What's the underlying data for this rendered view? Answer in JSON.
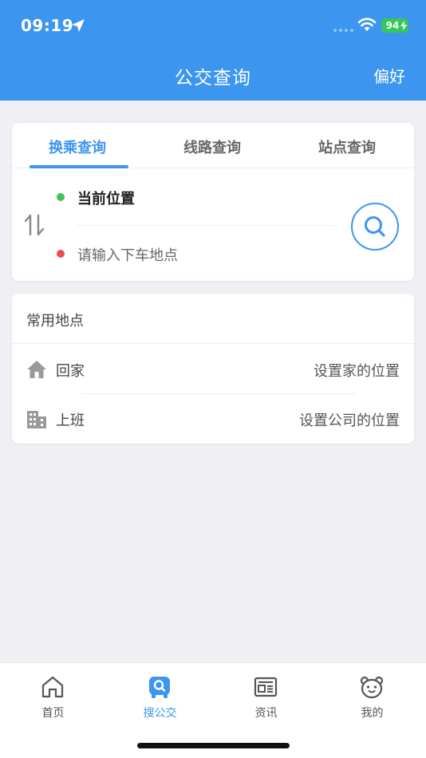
{
  "status_bar": {
    "time": "09:19",
    "battery": "94"
  },
  "nav": {
    "title": "公交查询",
    "right_button": "偏好"
  },
  "search_tabs": [
    {
      "label": "换乘查询",
      "active": true
    },
    {
      "label": "线路查询",
      "active": false
    },
    {
      "label": "站点查询",
      "active": false
    }
  ],
  "route": {
    "from": "当前位置",
    "to_placeholder": "请输入下车地点"
  },
  "places": {
    "title": "常用地点",
    "items": [
      {
        "label": "回家",
        "action": "设置家的位置",
        "icon": "house-icon"
      },
      {
        "label": "上班",
        "action": "设置公司的位置",
        "icon": "building-icon"
      }
    ]
  },
  "tabbar": [
    {
      "label": "首页",
      "icon": "home-icon",
      "active": false
    },
    {
      "label": "搜公交",
      "icon": "bus-search-icon",
      "active": true
    },
    {
      "label": "资讯",
      "icon": "news-icon",
      "active": false
    },
    {
      "label": "我的",
      "icon": "bear-face-icon",
      "active": false
    }
  ],
  "colors": {
    "accent": "#3c95ef",
    "green_dot": "#43c25a",
    "red_dot": "#ef4b4b",
    "battery": "#34c759"
  }
}
